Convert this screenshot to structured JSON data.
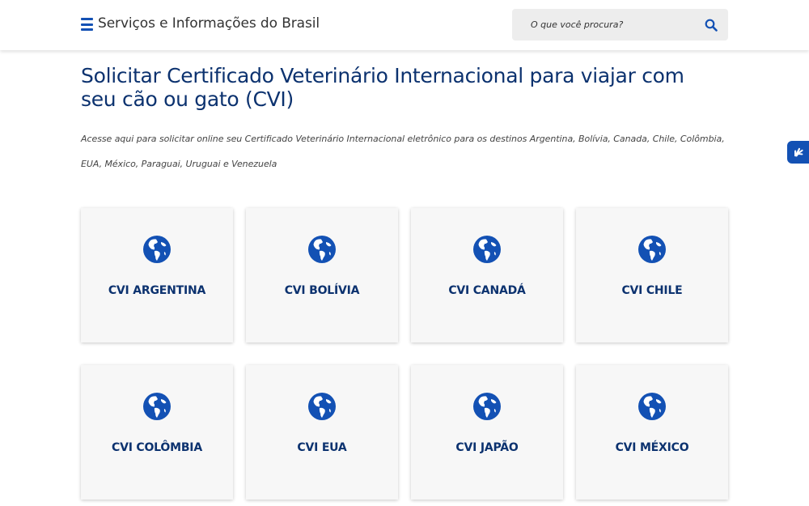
{
  "header": {
    "title": "Serviços e Informações do Brasil",
    "search_placeholder": "O que você procura?"
  },
  "page": {
    "title": "Solicitar Certificado Veterinário Internacional para viajar com seu cão ou gato (CVI)",
    "description": "Acesse aqui para solicitar online seu Certificado Veterinário Internacional eletrônico para os destinos Argentina, Bolívia, Canada, Chile, Colômbia, EUA, México, Paraguai, Uruguai e Venezuela"
  },
  "cards": [
    {
      "label": "CVI ARGENTINA",
      "icon": "globe-icon"
    },
    {
      "label": "CVI BOLÍVIA",
      "icon": "globe-icon"
    },
    {
      "label": "CVI CANADÁ",
      "icon": "globe-icon"
    },
    {
      "label": "CVI CHILE",
      "icon": "globe-icon"
    },
    {
      "label": "CVI COLÔMBIA",
      "icon": "globe-icon"
    },
    {
      "label": "CVI EUA",
      "icon": "globe-icon"
    },
    {
      "label": "CVI JAPÃO",
      "icon": "globe-icon"
    },
    {
      "label": "CVI MÉXICO",
      "icon": "globe-icon"
    }
  ],
  "colors": {
    "primary": "#1351b4",
    "title": "#0c326f",
    "card_bg": "#f7f7f7",
    "search_bg": "#ededed"
  },
  "icons": {
    "menu": "hamburger-menu-icon",
    "search": "search-icon",
    "accessibility": "vlibras-hands-icon"
  }
}
